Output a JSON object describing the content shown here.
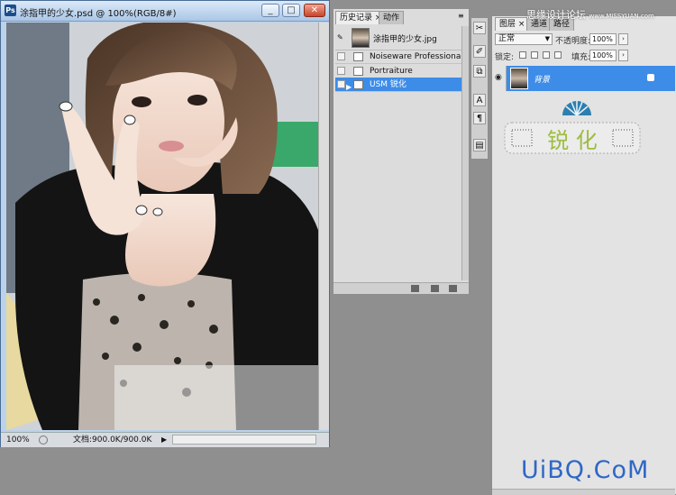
{
  "document": {
    "title": "涂指甲的少女.psd @ 100%(RGB/8#)",
    "zoom": "100%",
    "doc_size": "文档:900.0K/900.0K",
    "buttons": {
      "minimize": "_",
      "maximize": "□",
      "close": "✕"
    }
  },
  "history_panel": {
    "tabs": [
      "历史记录",
      "动作"
    ],
    "snapshot_name": "涂指甲的少女.jpg",
    "items": [
      {
        "label": "Noiseware Professional",
        "selected": false
      },
      {
        "label": "Portraiture",
        "selected": false
      },
      {
        "label": "USM 锐化",
        "selected": true
      }
    ]
  },
  "layers_panel": {
    "tabs": [
      "图层",
      "通道",
      "路径"
    ],
    "blend_mode": "正常",
    "opacity_label": "不透明度:",
    "opacity_value": "100%",
    "lock_label": "锁定:",
    "fill_label": "填充:",
    "fill_value": "100%",
    "layer_name": "背景"
  },
  "watermark_top": {
    "text": "思缘设计论坛",
    "site": "www.MISSYUAN.com"
  },
  "logo_brush_text": "锐 化",
  "uibq_logo": "UiBQ.CoM",
  "colors": {
    "selection": "#3d8ce8",
    "logo": "#2f67c6"
  }
}
